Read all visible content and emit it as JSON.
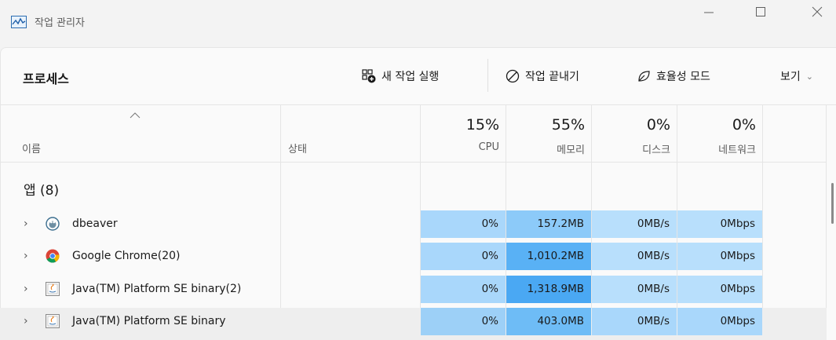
{
  "window": {
    "title": "작업 관리자"
  },
  "toolbar": {
    "page_title": "프로세스",
    "new_task": "새 작업 실행",
    "end_task": "작업 끝내기",
    "efficiency": "효율성 모드",
    "view": "보기"
  },
  "columns": {
    "name": "이름",
    "status": "상태",
    "cpu": {
      "pct": "15%",
      "label": "CPU"
    },
    "memory": {
      "pct": "55%",
      "label": "메모리"
    },
    "disk": {
      "pct": "0%",
      "label": "디스크"
    },
    "network": {
      "pct": "0%",
      "label": "네트워크"
    }
  },
  "group": {
    "label": "앱 (8)"
  },
  "processes": [
    {
      "name": "dbeaver",
      "icon": "dbeaver-icon",
      "cpu": "0%",
      "memory": "157.2MB",
      "disk": "0MB/s",
      "network": "0Mbps",
      "mem_color": "#8ccaf9"
    },
    {
      "name": "Google Chrome(20)",
      "icon": "chrome-icon",
      "cpu": "0%",
      "memory": "1,010.2MB",
      "disk": "0MB/s",
      "network": "0Mbps",
      "mem_color": "#59b1f5"
    },
    {
      "name": "Java(TM) Platform SE binary(2)",
      "icon": "java-icon",
      "cpu": "0%",
      "memory": "1,318.9MB",
      "disk": "0MB/s",
      "network": "0Mbps",
      "mem_color": "#4aa8f3"
    },
    {
      "name": "Java(TM) Platform SE binary",
      "icon": "java-icon",
      "cpu": "0%",
      "memory": "403.0MB",
      "disk": "0MB/s",
      "network": "0Mbps",
      "mem_color": "#6ebcf6"
    }
  ]
}
